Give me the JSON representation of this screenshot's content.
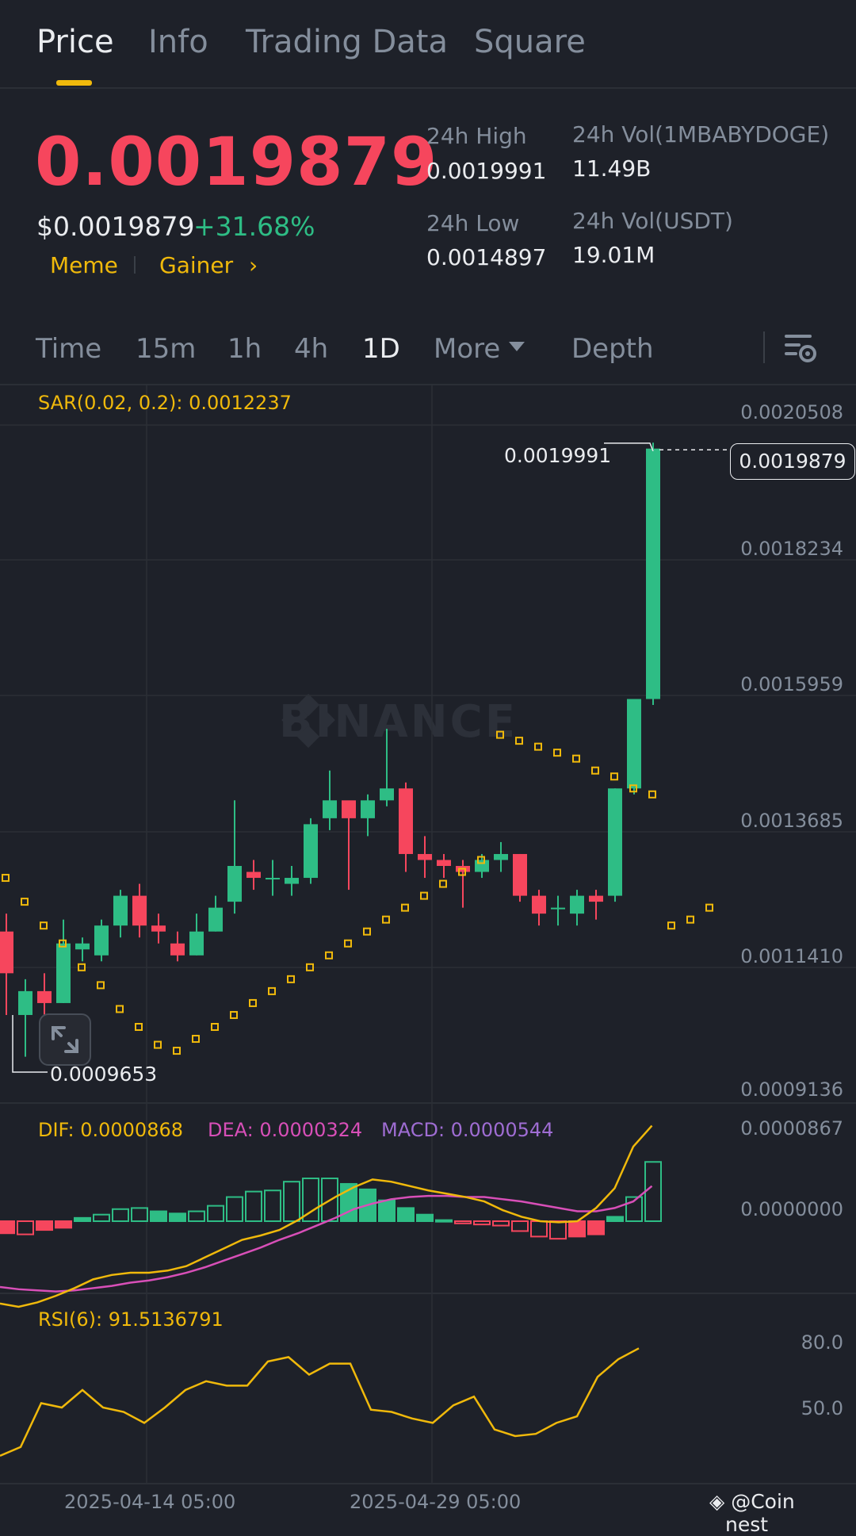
{
  "tabs": [
    {
      "label": "Price",
      "active": true
    },
    {
      "label": "Info",
      "active": false
    },
    {
      "label": "Trading Data",
      "active": false
    },
    {
      "label": "Square",
      "active": false
    }
  ],
  "ticker": {
    "last_price": "0.0019879",
    "usd_price": "$0.0019879",
    "change_pct": "+31.68%",
    "tags": [
      "Meme",
      "Gainer"
    ],
    "tag_arrow": "›",
    "high_24h_label": "24h High",
    "high_24h": "0.0019991",
    "low_24h_label": "24h Low",
    "low_24h": "0.0014897",
    "vol_base_label": "24h Vol(1MBABYDOGE)",
    "vol_base": "11.49B",
    "vol_quote_label": "24h Vol(USDT)",
    "vol_quote": "19.01M"
  },
  "timeframes": [
    {
      "label": "Time",
      "active": false
    },
    {
      "label": "15m",
      "active": false
    },
    {
      "label": "1h",
      "active": false
    },
    {
      "label": "4h",
      "active": false
    },
    {
      "label": "1D",
      "active": true
    },
    {
      "label": "More",
      "active": false
    },
    {
      "label": "Depth",
      "active": false
    }
  ],
  "colors": {
    "up": "#2ebd85",
    "down": "#f6465d",
    "accent": "#f0b90b",
    "dea": "#d84fb8",
    "macd": "#9f6dd3"
  },
  "watermark": "BINANCE",
  "chart_data": {
    "type": "candlestick",
    "sar_label": "SAR(0.02, 0.2): 0.0012237",
    "price_axis": [
      "0.0020508",
      "0.0018234",
      "0.0015959",
      "0.0013685",
      "0.0011410",
      "0.0009136"
    ],
    "current_price": "0.0019879",
    "high_marker": "0.0019991",
    "low_marker": "0.0009653",
    "x_labels": [
      "2025-04-14 05:00",
      "2025-04-29 05:00"
    ],
    "candles": [
      [
        0.00118,
        0.00121,
        0.00104,
        0.00111
      ],
      [
        0.00104,
        0.0011,
        0.00097,
        0.00108
      ],
      [
        0.00108,
        0.00111,
        0.00104,
        0.00106
      ],
      [
        0.00106,
        0.0012,
        0.00106,
        0.00116
      ],
      [
        0.00115,
        0.00117,
        0.00113,
        0.00116
      ],
      [
        0.00114,
        0.0012,
        0.00113,
        0.00119
      ],
      [
        0.00119,
        0.00125,
        0.00117,
        0.00124
      ],
      [
        0.00124,
        0.00126,
        0.00117,
        0.00119
      ],
      [
        0.00119,
        0.00121,
        0.00116,
        0.00118
      ],
      [
        0.00116,
        0.00118,
        0.00113,
        0.00114
      ],
      [
        0.00114,
        0.00121,
        0.00114,
        0.00118
      ],
      [
        0.00118,
        0.00124,
        0.00118,
        0.00122
      ],
      [
        0.00123,
        0.0014,
        0.00121,
        0.00129
      ],
      [
        0.00128,
        0.0013,
        0.00125,
        0.00127
      ],
      [
        0.00127,
        0.0013,
        0.00124,
        0.00127
      ],
      [
        0.00126,
        0.00129,
        0.00124,
        0.00127
      ],
      [
        0.00127,
        0.00137,
        0.00126,
        0.00136
      ],
      [
        0.00137,
        0.00145,
        0.00135,
        0.0014
      ],
      [
        0.0014,
        0.00138,
        0.00125,
        0.00137
      ],
      [
        0.00137,
        0.00141,
        0.00134,
        0.0014
      ],
      [
        0.0014,
        0.00152,
        0.00139,
        0.00142
      ],
      [
        0.00142,
        0.00143,
        0.00128,
        0.00131
      ],
      [
        0.00131,
        0.00134,
        0.00127,
        0.0013
      ],
      [
        0.0013,
        0.00131,
        0.00127,
        0.00129
      ],
      [
        0.00129,
        0.0013,
        0.00122,
        0.00128
      ],
      [
        0.00128,
        0.00131,
        0.00127,
        0.0013
      ],
      [
        0.0013,
        0.00133,
        0.00128,
        0.00131
      ],
      [
        0.00131,
        0.00131,
        0.00123,
        0.00124
      ],
      [
        0.00124,
        0.00125,
        0.00119,
        0.00121
      ],
      [
        0.00122,
        0.00124,
        0.00119,
        0.00122
      ],
      [
        0.00121,
        0.00125,
        0.00119,
        0.00124
      ],
      [
        0.00124,
        0.00125,
        0.0012,
        0.00123
      ],
      [
        0.00124,
        0.00142,
        0.00123,
        0.00142
      ],
      [
        0.00142,
        0.00157,
        0.00141,
        0.00157
      ],
      [
        0.00157,
        0.002,
        0.00156,
        0.00199
      ]
    ],
    "sar": [
      0.00131,
      0.00127,
      0.00123,
      0.00119,
      0.00116,
      0.00112,
      0.00109,
      0.00105,
      0.00102,
      0.00099,
      0.00098,
      0.001,
      0.00102,
      0.00104,
      0.00106,
      0.00108,
      0.0011,
      0.00112,
      0.00114,
      0.00116,
      0.00118,
      0.0012,
      0.00122,
      0.00124,
      0.00126,
      0.00128,
      0.0013,
      0.00151,
      0.0015,
      0.00149,
      0.00148,
      0.00147,
      0.00145,
      0.00144,
      0.00142,
      0.00141,
      0.00119,
      0.0012,
      0.00122
    ],
    "macd": {
      "dif_label": "DIF: 0.0000868",
      "dea_label": "DEA: 0.0000324",
      "macd_label": "MACD: 0.0000544",
      "axis": [
        "0.0000867",
        "0.0000000"
      ],
      "hist": [
        -1.1e-05,
        -1.2e-05,
        -8e-06,
        -6e-06,
        3e-06,
        6e-06,
        1.1e-05,
        1.2e-05,
        9e-06,
        7e-06,
        9e-06,
        1.4e-05,
        2.2e-05,
        2.7e-05,
        2.8e-05,
        3.6e-05,
        3.9e-05,
        3.9e-05,
        3.4e-05,
        2.9e-05,
        1.9e-05,
        1.2e-05,
        6e-06,
        1e-06,
        -2e-06,
        -3e-06,
        -4e-06,
        -9e-06,
        -1.4e-05,
        -1.6e-05,
        -1.4e-05,
        -1.2e-05,
        4e-06,
        2.2e-05,
        5.4e-05
      ],
      "dif": [
        -7.5e-05,
        -7.8e-05,
        -7.4e-05,
        -6.8e-05,
        -6.1e-05,
        -5.3e-05,
        -4.9e-05,
        -4.7e-05,
        -4.7e-05,
        -4.5e-05,
        -4.1e-05,
        -3.3e-05,
        -2.5e-05,
        -1.7e-05,
        -1.3e-05,
        -8e-06,
        1e-06,
        1.2e-05,
        2.2e-05,
        3.1e-05,
        3.8e-05,
        3.6e-05,
        3.2e-05,
        2.8e-05,
        2.5e-05,
        2.2e-05,
        1.8e-05,
        1e-05,
        4e-06,
        0.0,
        -1e-06,
        0.0,
        1.2e-05,
        3e-05,
        6.8e-05,
        8.7e-05
      ],
      "dea": [
        -6e-05,
        -6.2e-05,
        -6.3e-05,
        -6.4e-05,
        -6.3e-05,
        -6.1e-05,
        -5.9e-05,
        -5.6e-05,
        -5.4e-05,
        -5.1e-05,
        -4.7e-05,
        -4.2e-05,
        -3.6e-05,
        -3e-05,
        -2.4e-05,
        -1.7e-05,
        -1.1e-05,
        -4e-06,
        3e-06,
        1.1e-05,
        1.6e-05,
        2e-05,
        2.2e-05,
        2.3e-05,
        2.3e-05,
        2.2e-05,
        2.2e-05,
        2e-05,
        1.8e-05,
        1.5e-05,
        1.2e-05,
        9e-06,
        9e-06,
        1.2e-05,
        1.8e-05,
        3.2e-05
      ]
    },
    "rsi": {
      "label": "RSI(6): 91.5136791",
      "axis": [
        "80.0",
        "50.0"
      ],
      "values": [
        28,
        32,
        52,
        50,
        58,
        50,
        48,
        43,
        50,
        58,
        62,
        60,
        60,
        71,
        73,
        65,
        70,
        70,
        49,
        48,
        45,
        43,
        51,
        55,
        40,
        37,
        38,
        43,
        46,
        64,
        72,
        77
      ]
    }
  },
  "footer": {
    "coin_label": "@Coin",
    "next_label": "nest"
  }
}
